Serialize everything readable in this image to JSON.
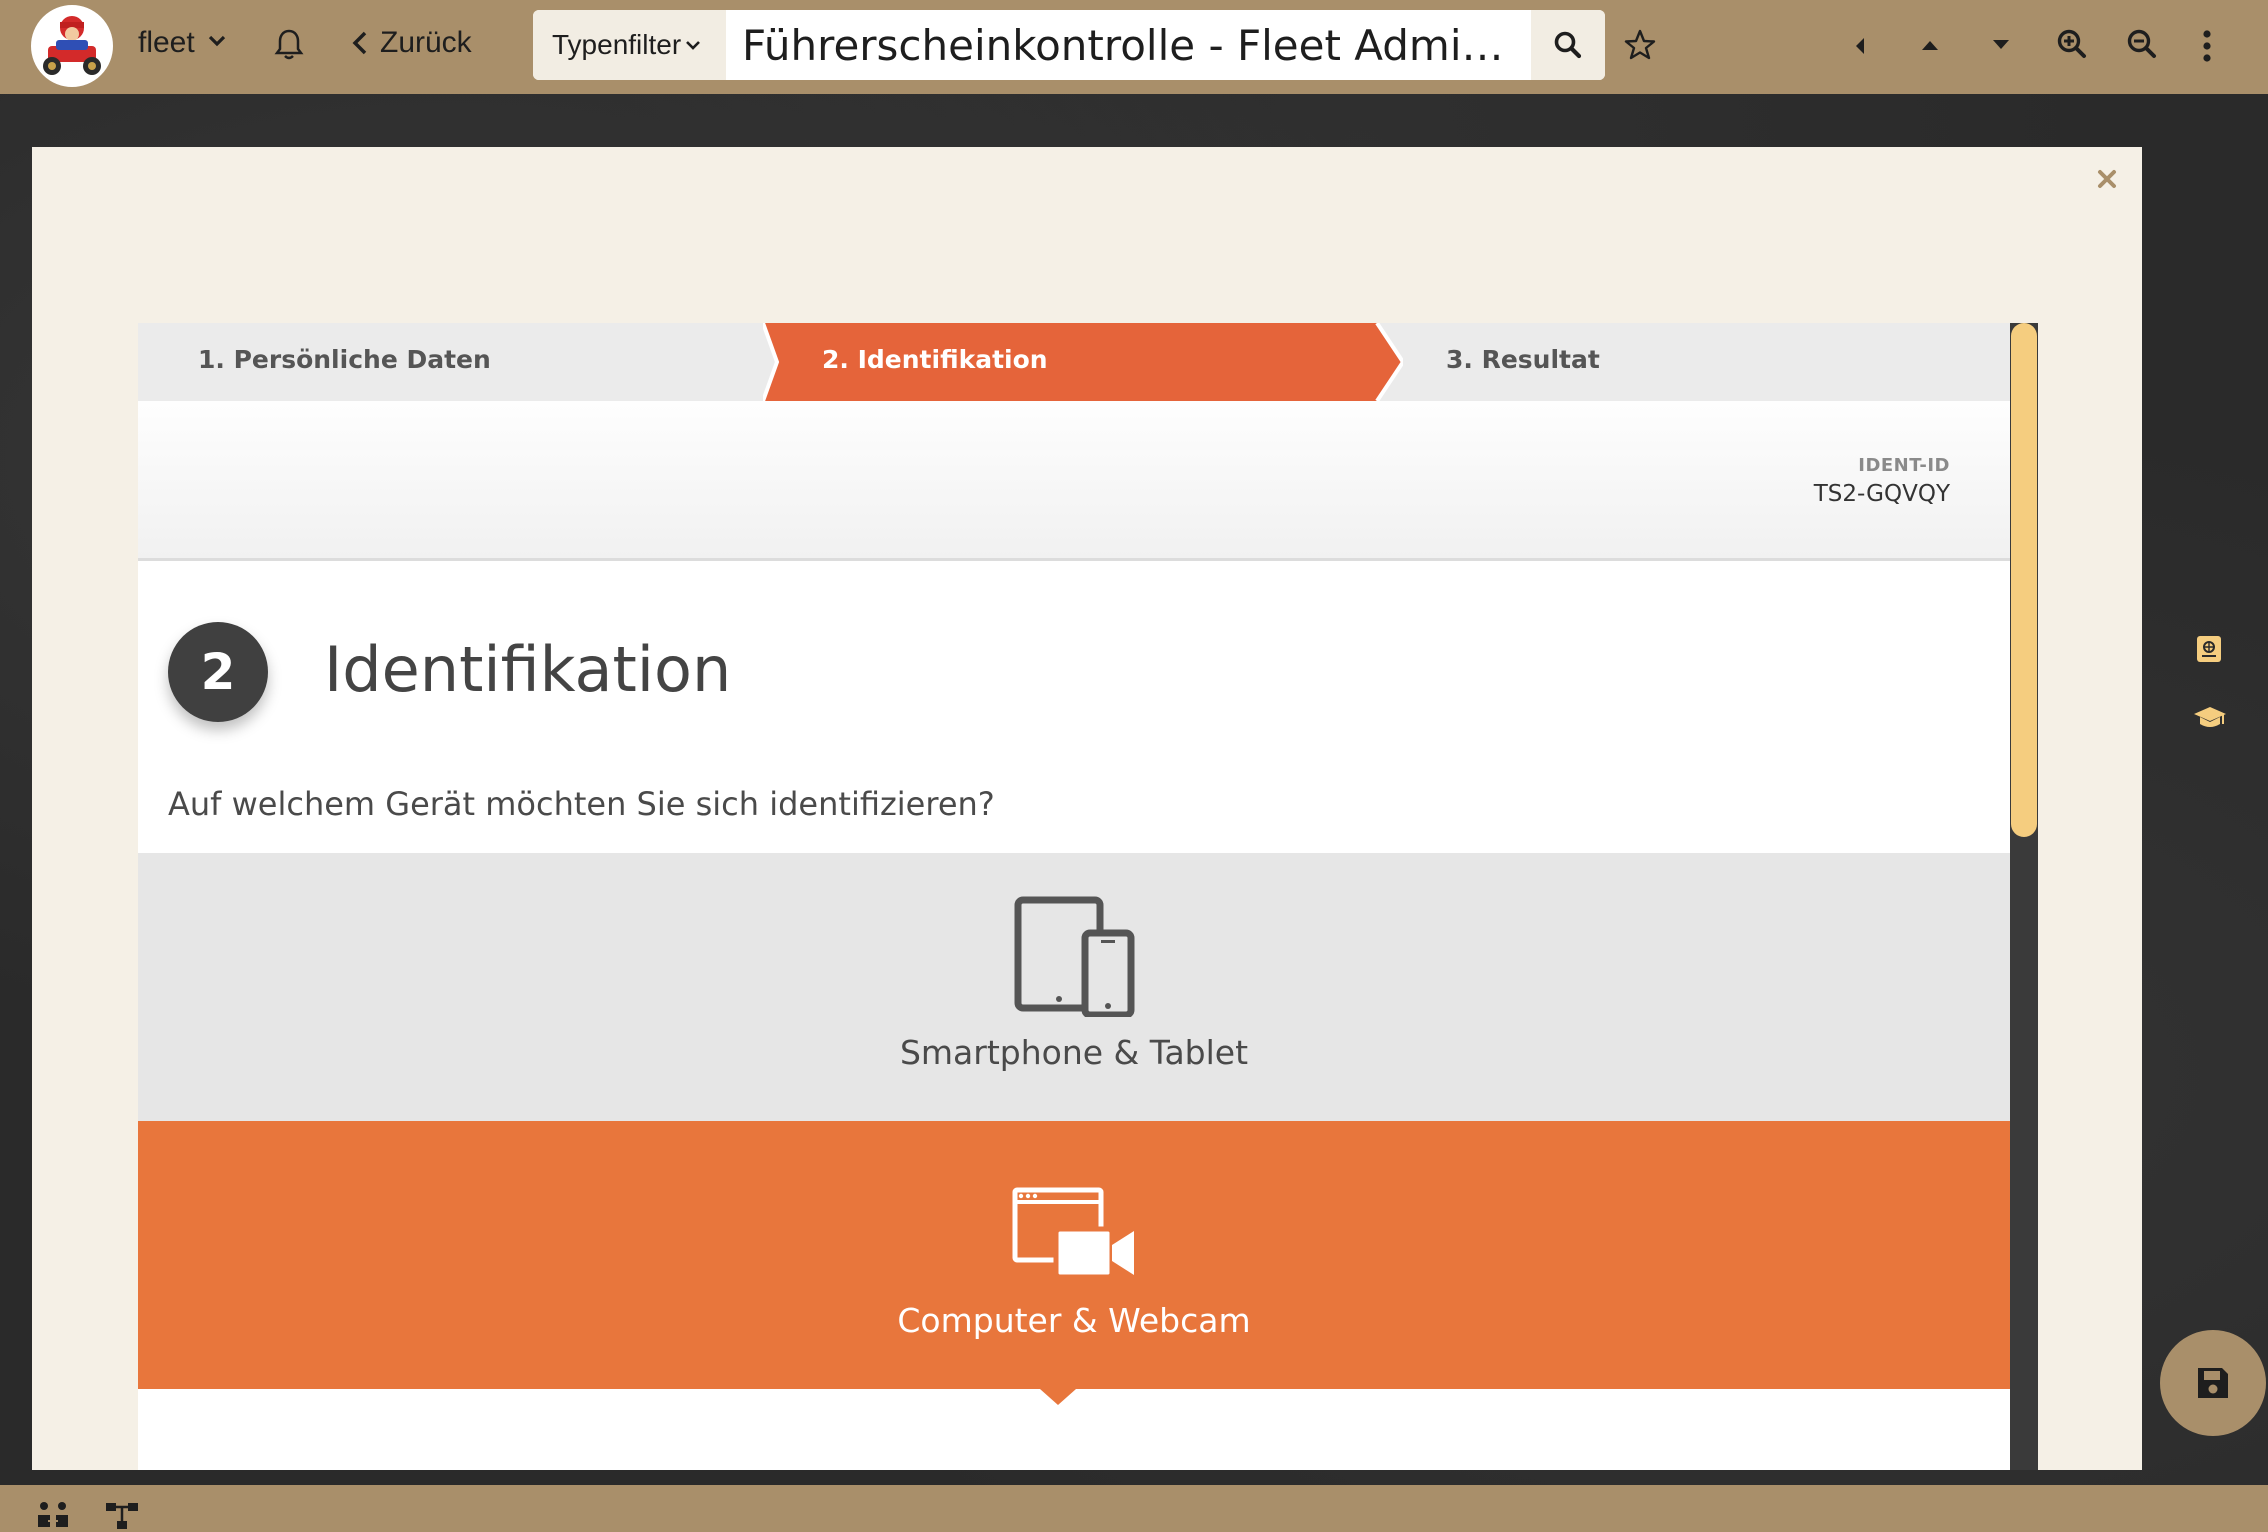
{
  "topbar": {
    "user_label": "fleet",
    "back_label": "Zurück",
    "typefilter_label": "Typenfilter",
    "search_value": "Führerscheinkontrolle - Fleet Admin..."
  },
  "wizard": {
    "steps": [
      {
        "label": "1. Persönliche Daten",
        "active": false
      },
      {
        "label": "2. Identifikation",
        "active": true
      },
      {
        "label": "3. Resultat",
        "active": false
      }
    ],
    "ident_key": "IDENT-ID",
    "ident_value": "TS2-GQVQY",
    "step_number": "2",
    "title": "Identifikation",
    "question": "Auf welchem Gerät möchten Sie sich identifizieren?",
    "options": [
      {
        "label": "Smartphone & Tablet",
        "icon": "devices-icon",
        "selected": false
      },
      {
        "label": "Computer & Webcam",
        "icon": "webcam-icon",
        "selected": true
      }
    ]
  },
  "colors": {
    "topbar": "#a98f6a",
    "accent": "#e8763c",
    "active_step": "#e5643a",
    "modal_bg": "#f5f0e6",
    "scroll_thumb": "#f5cd7f"
  }
}
